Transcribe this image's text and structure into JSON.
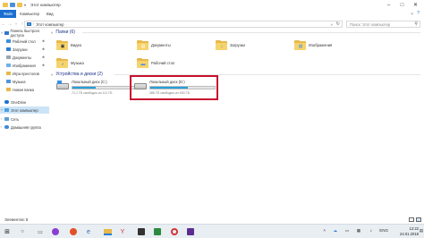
{
  "window": {
    "title": "Этот компьютер",
    "controls": [
      "minimize",
      "maximize",
      "close"
    ]
  },
  "ribbon": {
    "tabs": [
      "Файл",
      "Компьютер",
      "Вид"
    ],
    "help_icon": "help-icon"
  },
  "address": {
    "path": "Этот компьютер",
    "search_placeholder": "Поиск: Этот компьютер"
  },
  "sidebar": {
    "quick_access": "Панель быстрого доступа",
    "items": [
      {
        "label": "Рабочий стол",
        "icon": "desktop-icon",
        "pinned": true
      },
      {
        "label": "Загрузки",
        "icon": "download-icon",
        "pinned": true
      },
      {
        "label": "Документы",
        "icon": "documents-icon",
        "pinned": true
      },
      {
        "label": "Изображения",
        "icon": "pictures-icon",
        "pinned": true
      },
      {
        "label": "Игра престолов",
        "icon": "folder-icon",
        "pinned": false
      },
      {
        "label": "Музыка",
        "icon": "music-icon",
        "pinned": false
      },
      {
        "label": "Новая папка",
        "icon": "folder-icon",
        "pinned": false
      }
    ],
    "onedrive": "OneDrive",
    "this_pc": "Этот компьютер",
    "network": "Сеть",
    "homegroup": "Домашняя группа"
  },
  "main": {
    "folders_header": "Папки (6)",
    "folders": [
      {
        "label": "Видео",
        "icon": "video-icon"
      },
      {
        "label": "Документы",
        "icon": "documents-icon"
      },
      {
        "label": "Загрузки",
        "icon": "download-icon"
      },
      {
        "label": "Изображения",
        "icon": "pictures-icon"
      },
      {
        "label": "Музыка",
        "icon": "music-icon"
      },
      {
        "label": "Рабочий стол",
        "icon": "desktop-icon"
      }
    ],
    "drives_header": "Устройства и диски (2)",
    "drives": [
      {
        "name": "Локальный диск (C:)",
        "free": "71,1 ГБ свободно из 111 ГБ",
        "used_fraction": 0.36
      },
      {
        "name": "Локальный диск (D:)",
        "free": "386 ГБ свободно из 930 ГБ",
        "used_fraction": 0.58
      }
    ]
  },
  "status": {
    "items_count": "Элементов: 8"
  },
  "taskbar": {
    "lang": "ENG",
    "time": "12:22",
    "date": "24.01.2018"
  },
  "colors": {
    "accent": "#1a6fd1",
    "highlight_box": "#c8102e",
    "drive_bar": "#26a0da",
    "selection": "#cce4f7"
  }
}
